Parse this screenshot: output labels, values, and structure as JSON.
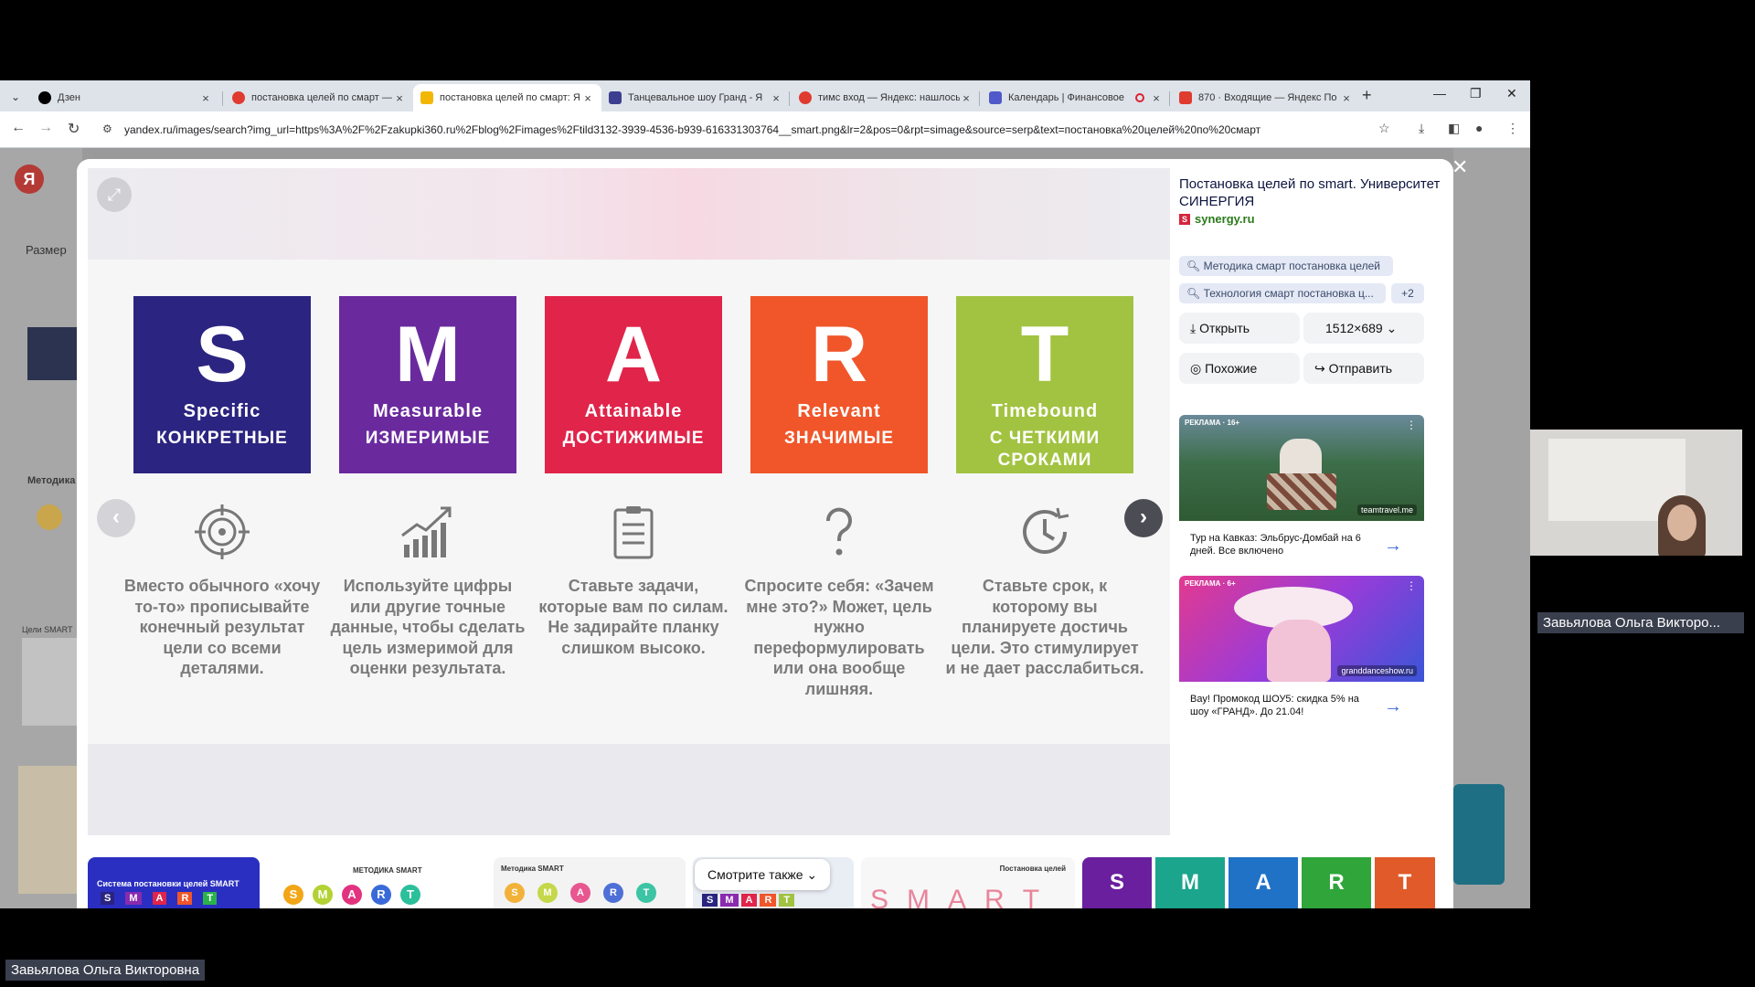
{
  "tabs": [
    {
      "title": "Дзен",
      "favicon_color": "#000000"
    },
    {
      "title": "постановка целей по смарт —",
      "favicon_color": "#e03b2f"
    },
    {
      "title": "постановка целей по смарт: Я",
      "favicon_color": "#f2b705"
    },
    {
      "title": "Танцевальное шоу Гранд - Я",
      "favicon_color": "#3c3f8f"
    },
    {
      "title": "тимс вход — Яндекс: нашлось",
      "favicon_color": "#e03b2f"
    },
    {
      "title": "Календарь | Финансовое",
      "favicon_color": "#5059c9"
    },
    {
      "title": "870 · Входящие — Яндекс По",
      "favicon_color": "#e03b2f"
    }
  ],
  "address": {
    "url": "yandex.ru/images/search?img_url=https%3A%2F%2Fzakupki360.ru%2Fblog%2Fimages%2Ftild3132-3939-4536-b939-616331303764__smart.png&lr=2&pos=0&rpt=simage&source=serp&text=постановка%20целей%20по%20смарт"
  },
  "background": {
    "logo": "Я",
    "size_filter": "Размер",
    "methods_label": "Методика",
    "section_label": "Цели SMART"
  },
  "smart": {
    "tiles": [
      {
        "letter": "S",
        "en": "Specific",
        "ru": "КОНКРЕТНЫЕ",
        "color": "#2b2480"
      },
      {
        "letter": "M",
        "en": "Measurable",
        "ru": "ИЗМЕРИМЫЕ",
        "color": "#6a2a9e"
      },
      {
        "letter": "A",
        "en": "Attainable",
        "ru": "ДОСТИЖИМЫЕ",
        "color": "#e0244a"
      },
      {
        "letter": "R",
        "en": "Relevant",
        "ru": "ЗНАЧИМЫЕ",
        "color": "#f0562a"
      },
      {
        "letter": "T",
        "en": "Timebound",
        "ru": "С ЧЕТКИМИ СРОКАМИ",
        "color": "#a2c341"
      }
    ],
    "descriptions": [
      "Вместо обычного «хочу то-то» прописывайте конечный результат цели со всеми деталями.",
      "Используйте цифры или другие точные данные, чтобы сделать цель измеримой для оценки результата.",
      "Ставьте задачи, которые вам по силам. Не задирайте планку слишком высоко.",
      "Спросите себя: «Зачем мне это?» Может, цель нужно переформулировать или она вообще лишняя.",
      "Ставьте срок, к которому вы планируете достичь цели. Это стимулирует и не дает расслабиться."
    ],
    "icons": [
      "target-icon",
      "growth-chart-icon",
      "clipboard-icon",
      "question-mark-icon",
      "clock-icon"
    ]
  },
  "side": {
    "title": "Постановка целей по smart. Университет СИНЕРГИЯ",
    "site": "synergy.ru",
    "chips": [
      "Методика смарт постановка целей",
      "Технология смарт постановка ц...",
      "+2"
    ],
    "open_label": "Открыть",
    "size_label": "1512×689",
    "similar_label": "Похожие",
    "send_label": "Отправить",
    "ads": [
      {
        "label": "РЕКЛАМА · 16+",
        "domain": "teamtravel.me",
        "text": "Тур на Кавказ: Эльбрус-Домбай на 6 дней. Все включено"
      },
      {
        "label": "РЕКЛАМА · 6+",
        "domain": "granddanceshow.ru",
        "text": "Вау! Промокод ШОУ5: скидка 5% на шоу «ГРАНД». До 21.04!"
      }
    ]
  },
  "strip": {
    "see_also": "Смотрите также",
    "thumbs": [
      {
        "title": "Система постановки целей SMART",
        "letters": [
          "S",
          "M",
          "A",
          "R",
          "T"
        ]
      },
      {
        "title": "МЕТОДИКА SMART",
        "letters": [
          "S",
          "M",
          "A",
          "R",
          "T"
        ]
      },
      {
        "title": "Методика SMART",
        "letters": [
          "S",
          "M",
          "A",
          "R",
          "T"
        ]
      },
      {
        "title": "",
        "letters": [
          "S",
          "M",
          "A",
          "R",
          "T"
        ]
      },
      {
        "title": "Постановка целей",
        "letters": [
          "S",
          "M",
          "A",
          "R",
          "T"
        ]
      },
      {
        "title": "",
        "letters": [
          "S",
          "M",
          "A",
          "R",
          "T"
        ]
      }
    ]
  },
  "call": {
    "participant_name_short": "Завьялова Ольга Викторо...",
    "participant_name_full": "Завьялова Ольга Викторовна"
  }
}
